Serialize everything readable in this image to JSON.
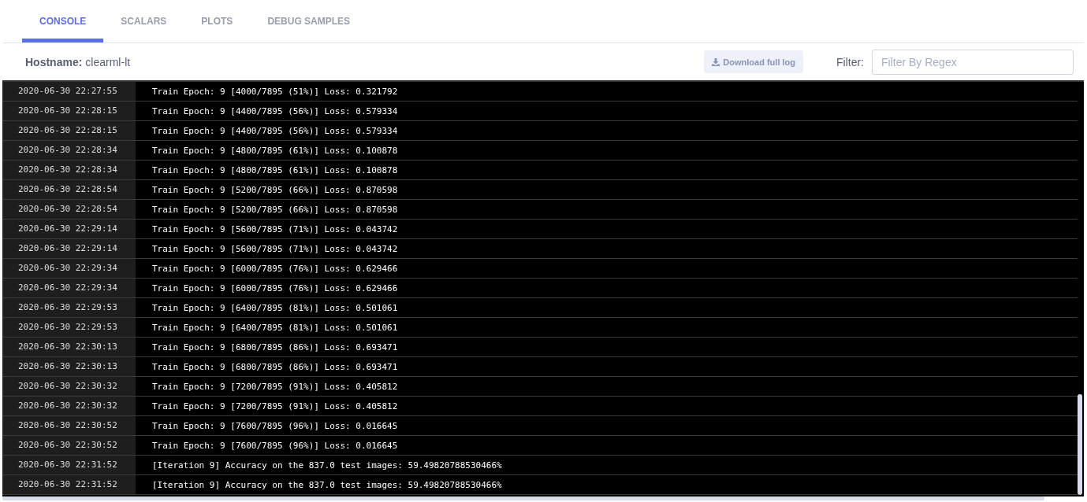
{
  "tabs": [
    {
      "label": "CONSOLE",
      "selected": true
    },
    {
      "label": "SCALARS",
      "selected": false
    },
    {
      "label": "PLOTS",
      "selected": false
    },
    {
      "label": "DEBUG SAMPLES",
      "selected": false
    }
  ],
  "hostname": {
    "label": "Hostname:",
    "value": "clearml-lt"
  },
  "download_button": {
    "label": "Download full log"
  },
  "filter": {
    "label": "Filter:",
    "placeholder": "Filter By Regex"
  },
  "log": [
    {
      "time": "2020-06-30 22:27:55",
      "message": "Train Epoch: 9 [4000/7895 (51%)] Loss: 0.321792"
    },
    {
      "time": "2020-06-30 22:28:15",
      "message": "Train Epoch: 9 [4400/7895 (56%)] Loss: 0.579334"
    },
    {
      "time": "2020-06-30 22:28:15",
      "message": "Train Epoch: 9 [4400/7895 (56%)] Loss: 0.579334"
    },
    {
      "time": "2020-06-30 22:28:34",
      "message": "Train Epoch: 9 [4800/7895 (61%)] Loss: 0.100878"
    },
    {
      "time": "2020-06-30 22:28:34",
      "message": "Train Epoch: 9 [4800/7895 (61%)] Loss: 0.100878"
    },
    {
      "time": "2020-06-30 22:28:54",
      "message": "Train Epoch: 9 [5200/7895 (66%)] Loss: 0.870598"
    },
    {
      "time": "2020-06-30 22:28:54",
      "message": "Train Epoch: 9 [5200/7895 (66%)] Loss: 0.870598"
    },
    {
      "time": "2020-06-30 22:29:14",
      "message": "Train Epoch: 9 [5600/7895 (71%)] Loss: 0.043742"
    },
    {
      "time": "2020-06-30 22:29:14",
      "message": "Train Epoch: 9 [5600/7895 (71%)] Loss: 0.043742"
    },
    {
      "time": "2020-06-30 22:29:34",
      "message": "Train Epoch: 9 [6000/7895 (76%)] Loss: 0.629466"
    },
    {
      "time": "2020-06-30 22:29:34",
      "message": "Train Epoch: 9 [6000/7895 (76%)] Loss: 0.629466"
    },
    {
      "time": "2020-06-30 22:29:53",
      "message": "Train Epoch: 9 [6400/7895 (81%)] Loss: 0.501061"
    },
    {
      "time": "2020-06-30 22:29:53",
      "message": "Train Epoch: 9 [6400/7895 (81%)] Loss: 0.501061"
    },
    {
      "time": "2020-06-30 22:30:13",
      "message": "Train Epoch: 9 [6800/7895 (86%)] Loss: 0.693471"
    },
    {
      "time": "2020-06-30 22:30:13",
      "message": "Train Epoch: 9 [6800/7895 (86%)] Loss: 0.693471"
    },
    {
      "time": "2020-06-30 22:30:32",
      "message": "Train Epoch: 9 [7200/7895 (91%)] Loss: 0.405812"
    },
    {
      "time": "2020-06-30 22:30:32",
      "message": "Train Epoch: 9 [7200/7895 (91%)] Loss: 0.405812"
    },
    {
      "time": "2020-06-30 22:30:52",
      "message": "Train Epoch: 9 [7600/7895 (96%)] Loss: 0.016645"
    },
    {
      "time": "2020-06-30 22:30:52",
      "message": "Train Epoch: 9 [7600/7895 (96%)] Loss: 0.016645"
    },
    {
      "time": "2020-06-30 22:31:52",
      "message": "[Iteration 9] Accuracy on the 837.0 test images: 59.49820788530466%"
    },
    {
      "time": "2020-06-30 22:31:52",
      "message": "[Iteration 9] Accuracy on the 837.0 test images: 59.49820788530466%"
    }
  ]
}
